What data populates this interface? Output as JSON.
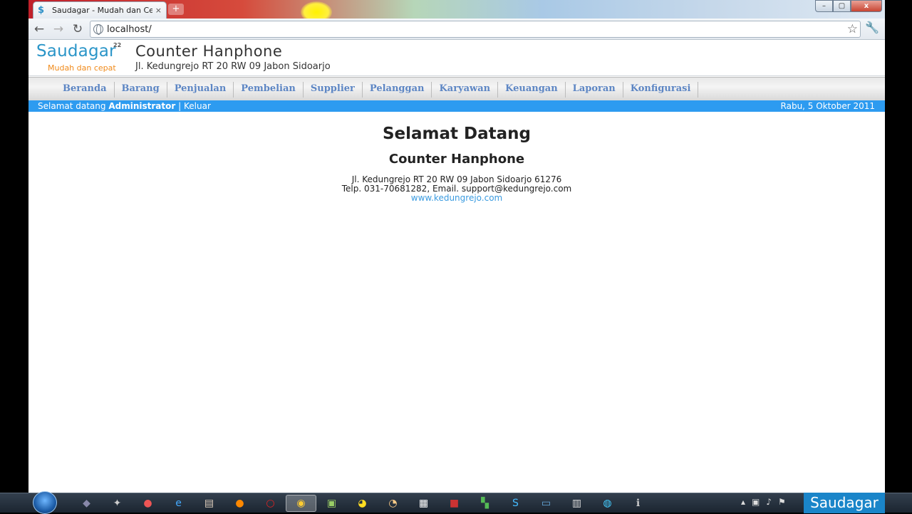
{
  "browser": {
    "tab_favicon": "$",
    "tab_title": "Saudagar - Mudah dan Cep",
    "tab_close": "×",
    "new_tab": "+",
    "url": "localhost/",
    "win_minimize": "–",
    "win_maximize": "▢",
    "win_close": "x"
  },
  "site": {
    "logo_text": "Saudagar",
    "logo_sup": "22",
    "logo_tagline": "Mudah dan cepat",
    "title": "Counter Hanphone",
    "address": "Jl. Kedungrejo RT 20 RW 09 Jabon Sidoarjo"
  },
  "menu": {
    "items": [
      {
        "label": "Beranda"
      },
      {
        "label": "Barang"
      },
      {
        "label": "Penjualan"
      },
      {
        "label": "Pembelian"
      },
      {
        "label": "Supplier"
      },
      {
        "label": "Pelanggan"
      },
      {
        "label": "Karyawan"
      },
      {
        "label": "Keuangan"
      },
      {
        "label": "Laporan"
      },
      {
        "label": "Konfigurasi"
      }
    ]
  },
  "status": {
    "welcome_prefix": "Selamat datang",
    "user": "Administrator",
    "separator": "|",
    "logout": "Keluar",
    "date": "Rabu, 5 Oktober 2011"
  },
  "content": {
    "heading": "Selamat Datang",
    "company": "Counter Hanphone",
    "address_line": "Jl. Kedungrejo RT 20 RW 09 Jabon Sidoarjo 61276",
    "contact_line": "Telp. 031-70681282, Email. support@kedungrejo.com",
    "website": "www.kedungrejo.com"
  },
  "taskbar": {
    "tray_label": "Saudagar"
  },
  "colors": {
    "accent_blue": "#2d9bf0",
    "logo_blue": "#2a95c8",
    "logo_orange": "#f08a1a",
    "menu_text": "#5d86c4"
  }
}
